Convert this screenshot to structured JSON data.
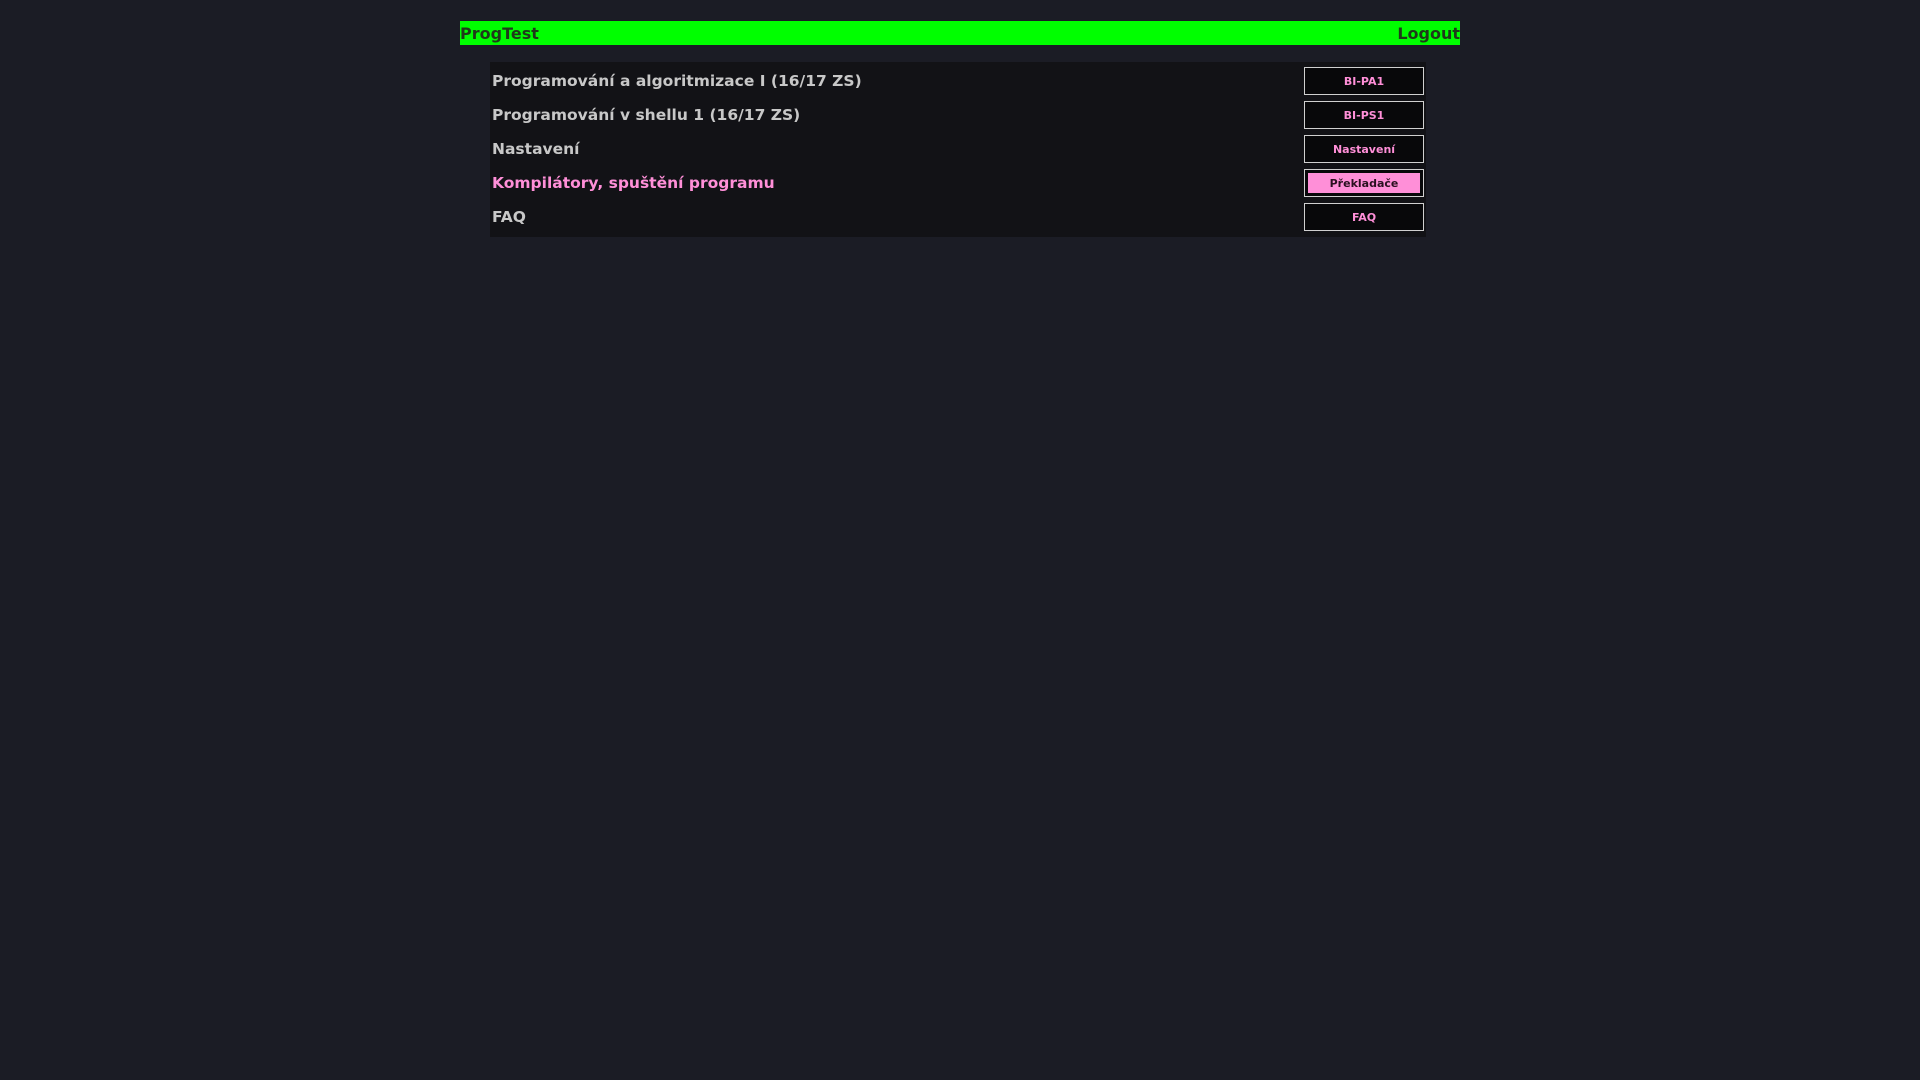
{
  "header": {
    "brand": "ProgTest",
    "logout_label": "Logout"
  },
  "menu": {
    "items": [
      {
        "label": "Programování a algoritmizace I (16/17 ZS)",
        "button": "BI-PA1",
        "active": false
      },
      {
        "label": "Programování v shellu 1 (16/17 ZS)",
        "button": "BI-PS1",
        "active": false
      },
      {
        "label": "Nastavení",
        "button": "Nastavení",
        "active": false
      },
      {
        "label": "Kompilátory, spuštění programu",
        "button": "Překladače",
        "active": true
      },
      {
        "label": "FAQ",
        "button": "FAQ",
        "active": false
      }
    ]
  },
  "colors": {
    "background": "#1b1c25",
    "topbar": "#00ff00",
    "accent_pink": "#ff8fd8",
    "menu_bg": "#121216"
  }
}
